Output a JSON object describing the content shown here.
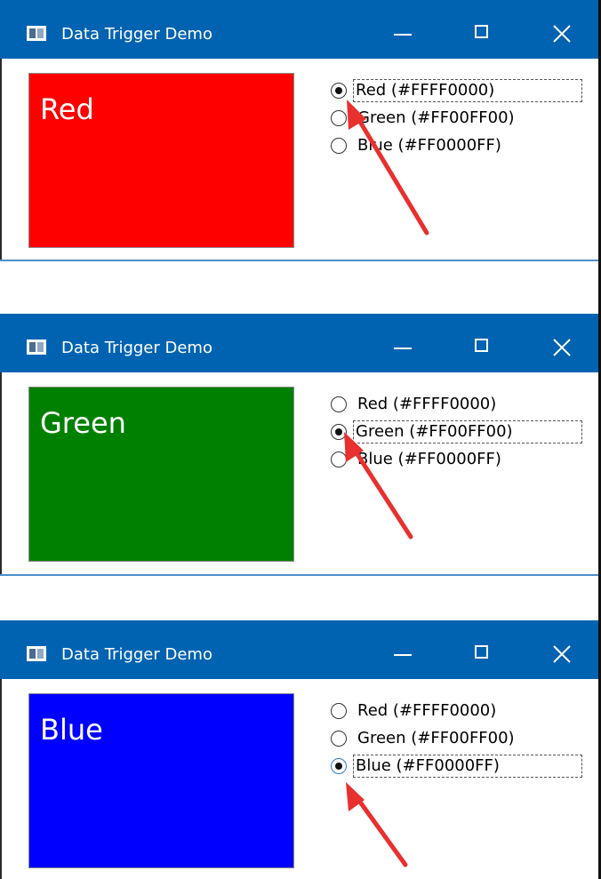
{
  "windows": [
    {
      "title": "Data Trigger Demo",
      "box_label": "Red",
      "box_color": "#FF0000",
      "selected_index": 0,
      "options": [
        {
          "label": "Red (#FFFF0000)"
        },
        {
          "label": "Green (#FF00FF00)"
        },
        {
          "label": "Blue (#FF0000FF)"
        }
      ]
    },
    {
      "title": "Data Trigger Demo",
      "box_label": "Green",
      "box_color": "#008000",
      "selected_index": 1,
      "options": [
        {
          "label": "Red (#FFFF0000)"
        },
        {
          "label": "Green (#FF00FF00)"
        },
        {
          "label": "Blue (#FF0000FF)"
        }
      ]
    },
    {
      "title": "Data Trigger Demo",
      "box_label": "Blue",
      "box_color": "#0000FF",
      "selected_index": 2,
      "options": [
        {
          "label": "Red (#FFFF0000)"
        },
        {
          "label": "Green (#FF00FF00)"
        },
        {
          "label": "Blue (#FF0000FF)"
        }
      ]
    }
  ],
  "colors": {
    "title_bar": "#0063B1",
    "annotation_arrow": "#E8302F"
  }
}
